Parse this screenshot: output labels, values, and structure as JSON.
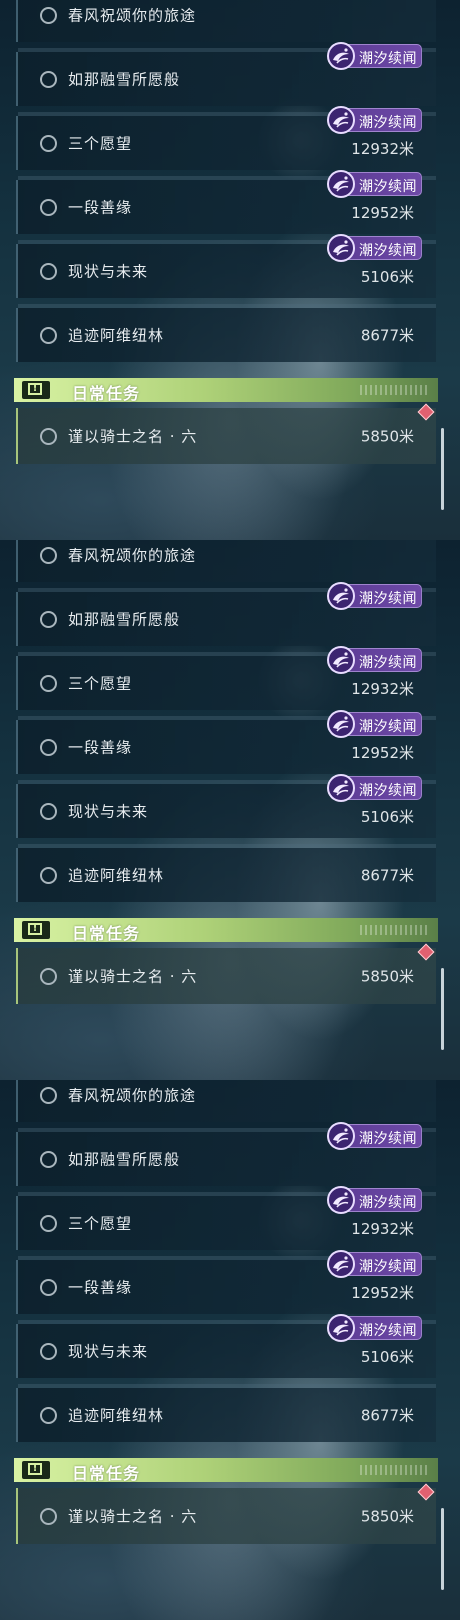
{
  "frames": [
    {
      "quests": [
        {
          "name": "春风祝颂你的旅途",
          "distance": "",
          "tag": ""
        },
        {
          "name": "如那融雪所愿般",
          "distance": "",
          "tag": "潮汐续闻"
        },
        {
          "name": "三个愿望",
          "distance": "12932米",
          "tag": "潮汐续闻"
        },
        {
          "name": "一段善缘",
          "distance": "12952米",
          "tag": "潮汐续闻"
        },
        {
          "name": "现状与未来",
          "distance": "5106米",
          "tag": "潮汐续闻"
        },
        {
          "name": "追迹阿维纽林",
          "distance": "8677米",
          "tag": ""
        }
      ],
      "daily_title": "日常任务",
      "daily_quest": {
        "name": "谨以骑士之名 · 六",
        "distance": "5850米"
      }
    },
    {
      "quests": [
        {
          "name": "春风祝颂你的旅途",
          "distance": "",
          "tag": ""
        },
        {
          "name": "如那融雪所愿般",
          "distance": "",
          "tag": "潮汐续闻"
        },
        {
          "name": "三个愿望",
          "distance": "12932米",
          "tag": "潮汐续闻"
        },
        {
          "name": "一段善缘",
          "distance": "12952米",
          "tag": "潮汐续闻"
        },
        {
          "name": "现状与未来",
          "distance": "5106米",
          "tag": "潮汐续闻"
        },
        {
          "name": "追迹阿维纽林",
          "distance": "8677米",
          "tag": ""
        }
      ],
      "daily_title": "日常任务",
      "daily_quest": {
        "name": "谨以骑士之名 · 六",
        "distance": "5850米"
      }
    },
    {
      "quests": [
        {
          "name": "春风祝颂你的旅途",
          "distance": "",
          "tag": ""
        },
        {
          "name": "如那融雪所愿般",
          "distance": "",
          "tag": "潮汐续闻"
        },
        {
          "name": "三个愿望",
          "distance": "12932米",
          "tag": "潮汐续闻"
        },
        {
          "name": "一段善缘",
          "distance": "12952米",
          "tag": "潮汐续闻"
        },
        {
          "name": "现状与未来",
          "distance": "5106米",
          "tag": "潮汐续闻"
        },
        {
          "name": "追迹阿维纽林",
          "distance": "8677米",
          "tag": ""
        }
      ],
      "daily_title": "日常任务",
      "daily_quest": {
        "name": "谨以骑士之名 · 六",
        "distance": "5850米"
      }
    }
  ],
  "colors": {
    "tag_purple": "#6e4aa8",
    "daily_green": "#aed178",
    "marker_red": "#e06070"
  },
  "icons": {
    "quest_status": "radio-circle-icon",
    "tag": "tide-swirl-icon",
    "daily_header": "alert-icon",
    "daily_marker": "red-diamond-icon"
  }
}
